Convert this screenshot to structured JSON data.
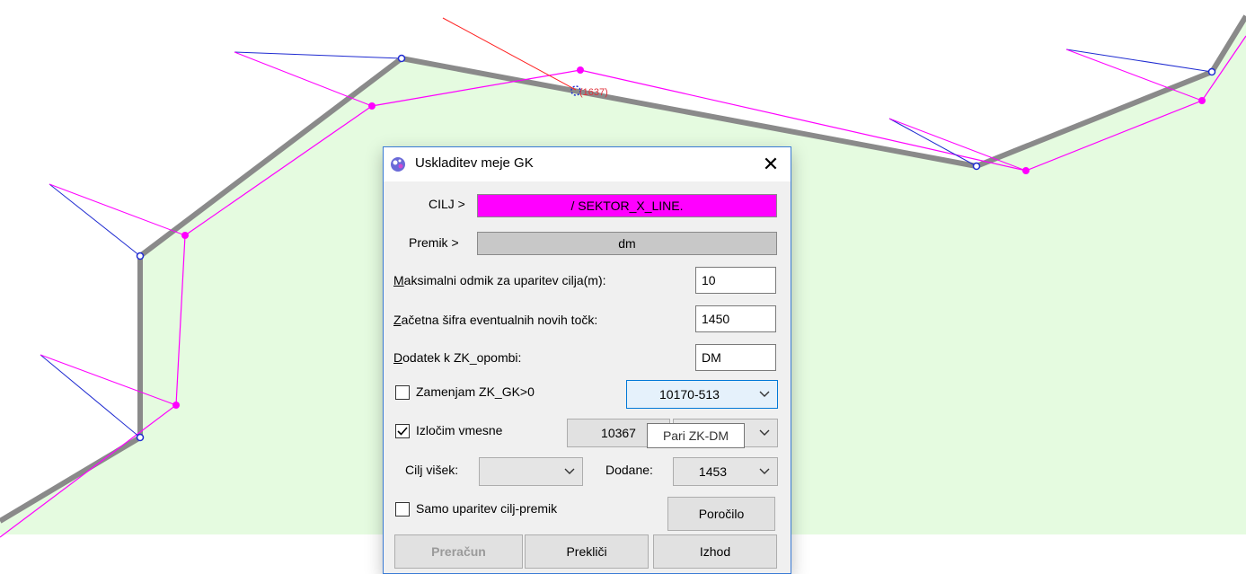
{
  "map": {
    "point_label": "(1637)",
    "colors": {
      "background_fill": "#e5fbe0",
      "boundary": "#8a8a8a",
      "magenta": "#ff00ff",
      "blue": "#1f2bd1",
      "red": "#ff2020"
    }
  },
  "dialog": {
    "title": "Uskladitev meje GK",
    "icon": "app-icon",
    "cilj_label": "CILJ >",
    "cilj_value": "/ SEKTOR_X_LINE.",
    "cilj_color": "#ff00ff",
    "premik_label": "Premik >",
    "premik_value": "dm",
    "max_odmik_label": "Maksimalni odmik za uparitev cilja(m):",
    "max_odmik_value": "10",
    "zacetna_sifra_label": "Začetna šifra eventualnih novih točk:",
    "zacetna_sifra_value": "1450",
    "dodatek_label": "Dodatek k ZK_opombi:",
    "dodatek_value": "DM",
    "zamenjam_label": "Zamenjam ZK_GK>0",
    "zamenjam_checked": false,
    "zamenjam_combo_value": "10170-513",
    "izlocim_label": "Izločim vmesne",
    "izlocim_checked": true,
    "izlocim_value1": "10367",
    "tooltip": "Pari ZK-DM",
    "cilj_visek_label": "Cilj višek:",
    "cilj_visek_value": "",
    "dodane_label": "Dodane:",
    "dodane_value": "1453",
    "samo_label": "Samo uparitev cilj-premik",
    "samo_checked": false,
    "porocilo_label": "Poročilo",
    "preracun_label": "Preračun",
    "preklici_label": "Prekliči",
    "izhod_label": "Izhod"
  }
}
